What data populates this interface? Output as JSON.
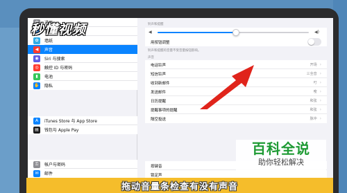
{
  "watermark": "秒懂视频",
  "sidebar": {
    "group1": [
      {
        "label": "通用",
        "icon": "gear-icon",
        "color": "#8e8e93",
        "glyph": "⚙"
      },
      {
        "label": "显示与亮度",
        "icon": "display-icon",
        "color": "#0a84ff",
        "glyph": "A"
      },
      {
        "label": "墙纸",
        "icon": "wallpaper-icon",
        "color": "#32ade6",
        "glyph": "✿"
      },
      {
        "label": "声音",
        "icon": "speaker-icon",
        "color": "#ff3b30",
        "glyph": "◀",
        "active": true
      },
      {
        "label": "Siri 与搜索",
        "icon": "siri-icon",
        "color": "#5e5ce6",
        "glyph": "◉"
      },
      {
        "label": "触控 ID 与密码",
        "icon": "fingerprint-icon",
        "color": "#ff3b30",
        "glyph": "◎"
      },
      {
        "label": "电池",
        "icon": "battery-icon",
        "color": "#34c759",
        "glyph": "▮"
      },
      {
        "label": "隐私",
        "icon": "privacy-hand-icon",
        "color": "#0a84ff",
        "glyph": "✋"
      }
    ],
    "group2": [
      {
        "label": "iTunes Store 与 App Store",
        "icon": "app-store-icon",
        "color": "#0a84ff",
        "glyph": "A"
      },
      {
        "label": "钱包与 Apple Pay",
        "icon": "wallet-icon",
        "color": "#1c1c1e",
        "glyph": "▤"
      }
    ],
    "group3": [
      {
        "label": "帐户与密码",
        "icon": "key-icon",
        "color": "#8e8e93",
        "glyph": "⚿"
      },
      {
        "label": "邮件",
        "icon": "mail-icon",
        "color": "#0a84ff",
        "glyph": "✉"
      }
    ]
  },
  "detail": {
    "volume_caption": "铃声和提醒",
    "volume_level": 0.52,
    "adjust_with_buttons": "用按钮调整",
    "adjust_with_buttons_on": false,
    "adjust_caption": "铃声和提醒的音量不受音量按钮影响。",
    "sounds_caption": "声音",
    "sounds": [
      {
        "label": "电话铃声",
        "value": "开场"
      },
      {
        "label": "短信铃声",
        "value": "三全音"
      },
      {
        "label": "收到新邮件",
        "value": "叮"
      },
      {
        "label": "发送邮件",
        "value": "嗖"
      },
      {
        "label": "日历提醒",
        "value": "和弦"
      },
      {
        "label": "提醒事项的提醒",
        "value": "和弦"
      },
      {
        "label": "隔空投送",
        "value": "脉冲"
      }
    ],
    "keyboard_clicks": "按键音",
    "lock_sound": "锁定声"
  },
  "brand": {
    "title": "百科全说",
    "subtitle": "助你轻松解决"
  },
  "subtitle_bar": "拖动音量条检查有没有声音",
  "colors": {
    "accent": "#0a84ff",
    "arrow": "#e0241b",
    "subtitle_bg": "#f5bd2b",
    "brand_green": "#1d9a33"
  }
}
